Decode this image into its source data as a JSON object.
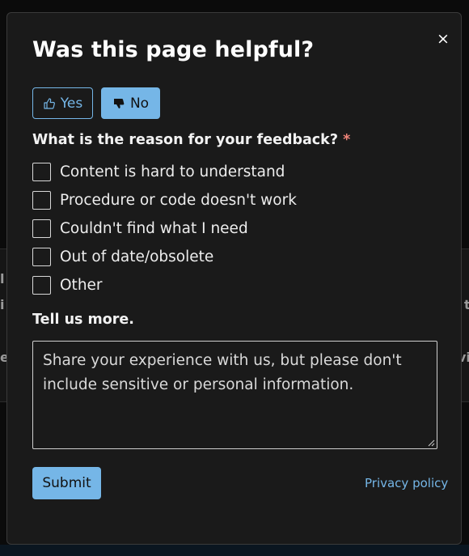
{
  "backdrop": {
    "fragments": [
      "l",
      "i",
      "e",
      "t",
      "vi"
    ]
  },
  "dialog": {
    "title": "Was this page helpful?",
    "close_glyph": "×",
    "yes_label": "Yes",
    "no_label": "No",
    "selected": "No",
    "question": "What is the reason for your feedback?",
    "required_mark": "*",
    "options": [
      {
        "label": "Content is hard to understand",
        "checked": false
      },
      {
        "label": "Procedure or code doesn't work",
        "checked": false
      },
      {
        "label": "Couldn't find what I need",
        "checked": false
      },
      {
        "label": "Out of date/obsolete",
        "checked": false
      },
      {
        "label": "Other",
        "checked": false
      }
    ],
    "tell_label": "Tell us more.",
    "textarea_placeholder": "Share your experience with us, but please don't include sensitive or personal information.",
    "textarea_value": "",
    "submit_label": "Submit",
    "privacy_label": "Privacy policy"
  },
  "icons": {
    "yes": "thumbs-up-icon",
    "no": "thumbs-down-icon",
    "close": "close-icon"
  },
  "colors": {
    "accent": "#75b6e7",
    "dialog_bg": "#1a1a1a",
    "required": "#f0857a"
  }
}
